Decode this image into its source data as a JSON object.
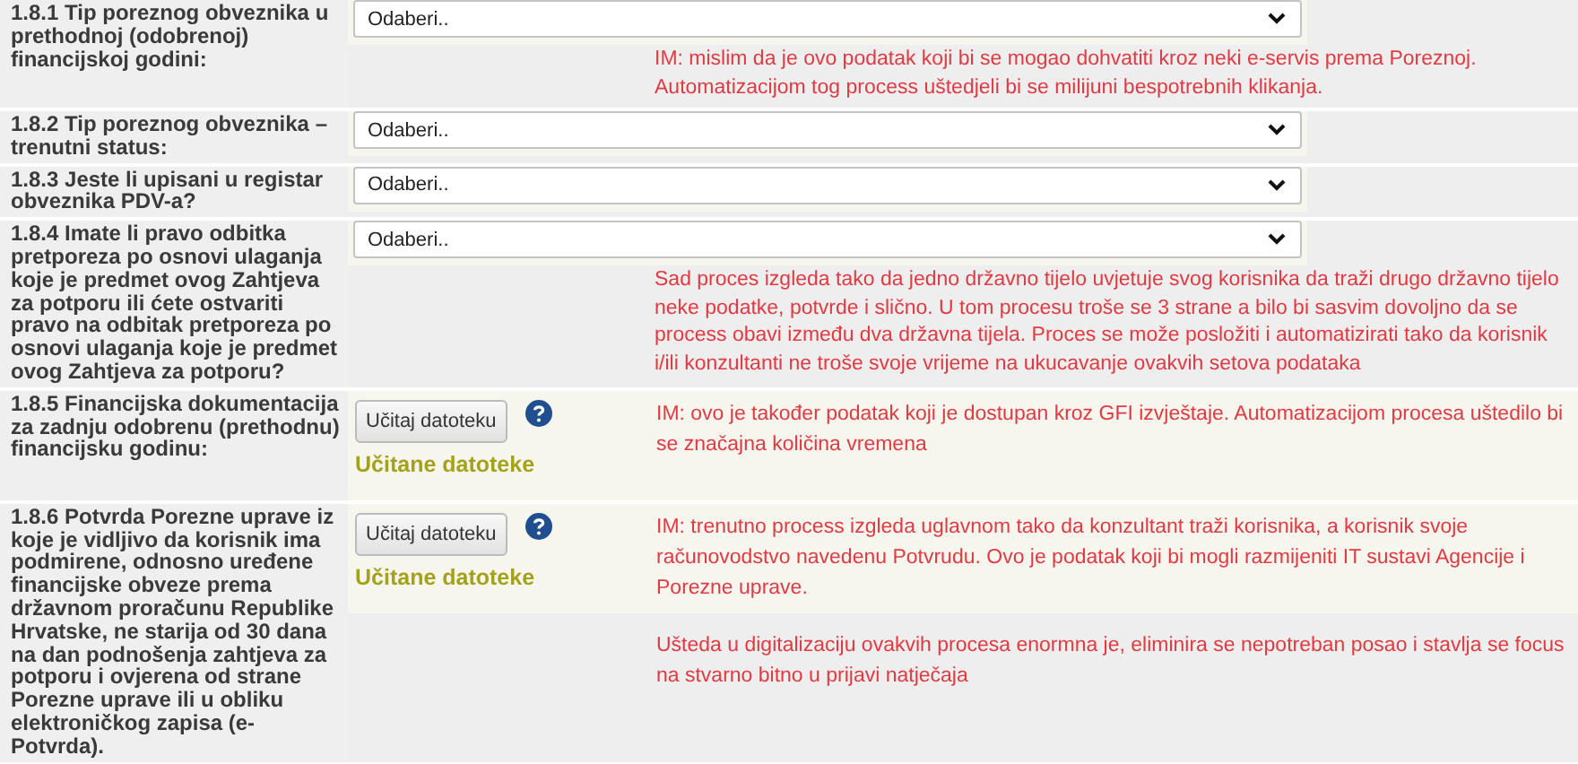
{
  "rows": [
    {
      "kind": "select",
      "label": "1.8.1 Tip poreznog obveznika u prethodnoj (odobrenoj) financijskoj godini:",
      "value": "Odaberi..",
      "comments": [
        "IM: mislim da je ovo podatak koji bi se mogao dohvatiti kroz neki e-servis prema Poreznoj. Automatizacijom tog process uštedjeli bi se milijuni bespotrebnih klikanja."
      ]
    },
    {
      "kind": "select",
      "label": "1.8.2 Tip poreznog obveznika – trenutni status:",
      "value": "Odaberi..",
      "comments": []
    },
    {
      "kind": "select",
      "label": "1.8.3 Jeste li upisani u registar obveznika PDV-a?",
      "value": "Odaberi..",
      "comments": []
    },
    {
      "kind": "select",
      "label": "1.8.4 Imate li pravo odbitka pretporeza po osnovi ulaganja koje je predmet ovog Zahtjeva za potporu ili ćete ostvariti pravo na odbitak pretporeza po osnovi ulaganja koje je predmet ovog Zahtjeva za potporu?",
      "value": "Odaberi..",
      "comments": [
        "Sad proces izgleda tako da jedno državno tijelo uvjetuje svog korisnika da traži drugo državno tijelo neke podatke, potvrde i slično. U tom procesu troše se 3 strane a bilo bi sasvim dovoljno da se process obavi između dva državna tijela. Proces se može posložiti i automatizirati tako da korisnik i/ili konzultanti ne troše svoje vrijeme na ukucavanje ovakvih setova podataka"
      ]
    },
    {
      "kind": "upload",
      "label": "1.8.5 Financijska dokumentacija za zadnju odobrenu (prethodnu) financijsku godinu:",
      "button": "Učitaj datoteku",
      "status": "Učitane datoteke",
      "comments": [
        "IM: ovo je također podatak koji je dostupan kroz GFI izvještaje. Automatizacijom procesa uštedilo bi se značajna količina vremena"
      ]
    },
    {
      "kind": "upload",
      "label": "1.8.6 Potvrda Porezne uprave iz koje je vidljivo da korisnik ima podmirene, odnosno uređene financijske obveze prema državnom proračunu Republike Hrvatske, ne starija od 30 dana na dan podnošenja zahtjeva za potporu i ovjerena od strane Porezne uprave ili u obliku elektroničkog zapisa (e-Potvrda).",
      "button": "Učitaj datoteku",
      "status": "Učitane datoteke",
      "comments": [
        "IM: trenutno process izgleda uglavnom tako da konzultant traži korisnika, a korisnik svoje računovodstvo navedenu Potvrudu. Ovo je podatak koji bi mogli razmijeniti IT sustavi Agencije i Porezne uprave.",
        "Ušteda u digitalizaciju ovakvih procesa enormna je, eliminira se nepotreban posao i stavlja se focus na stvarno bitno u prijavi natječaja"
      ]
    }
  ]
}
